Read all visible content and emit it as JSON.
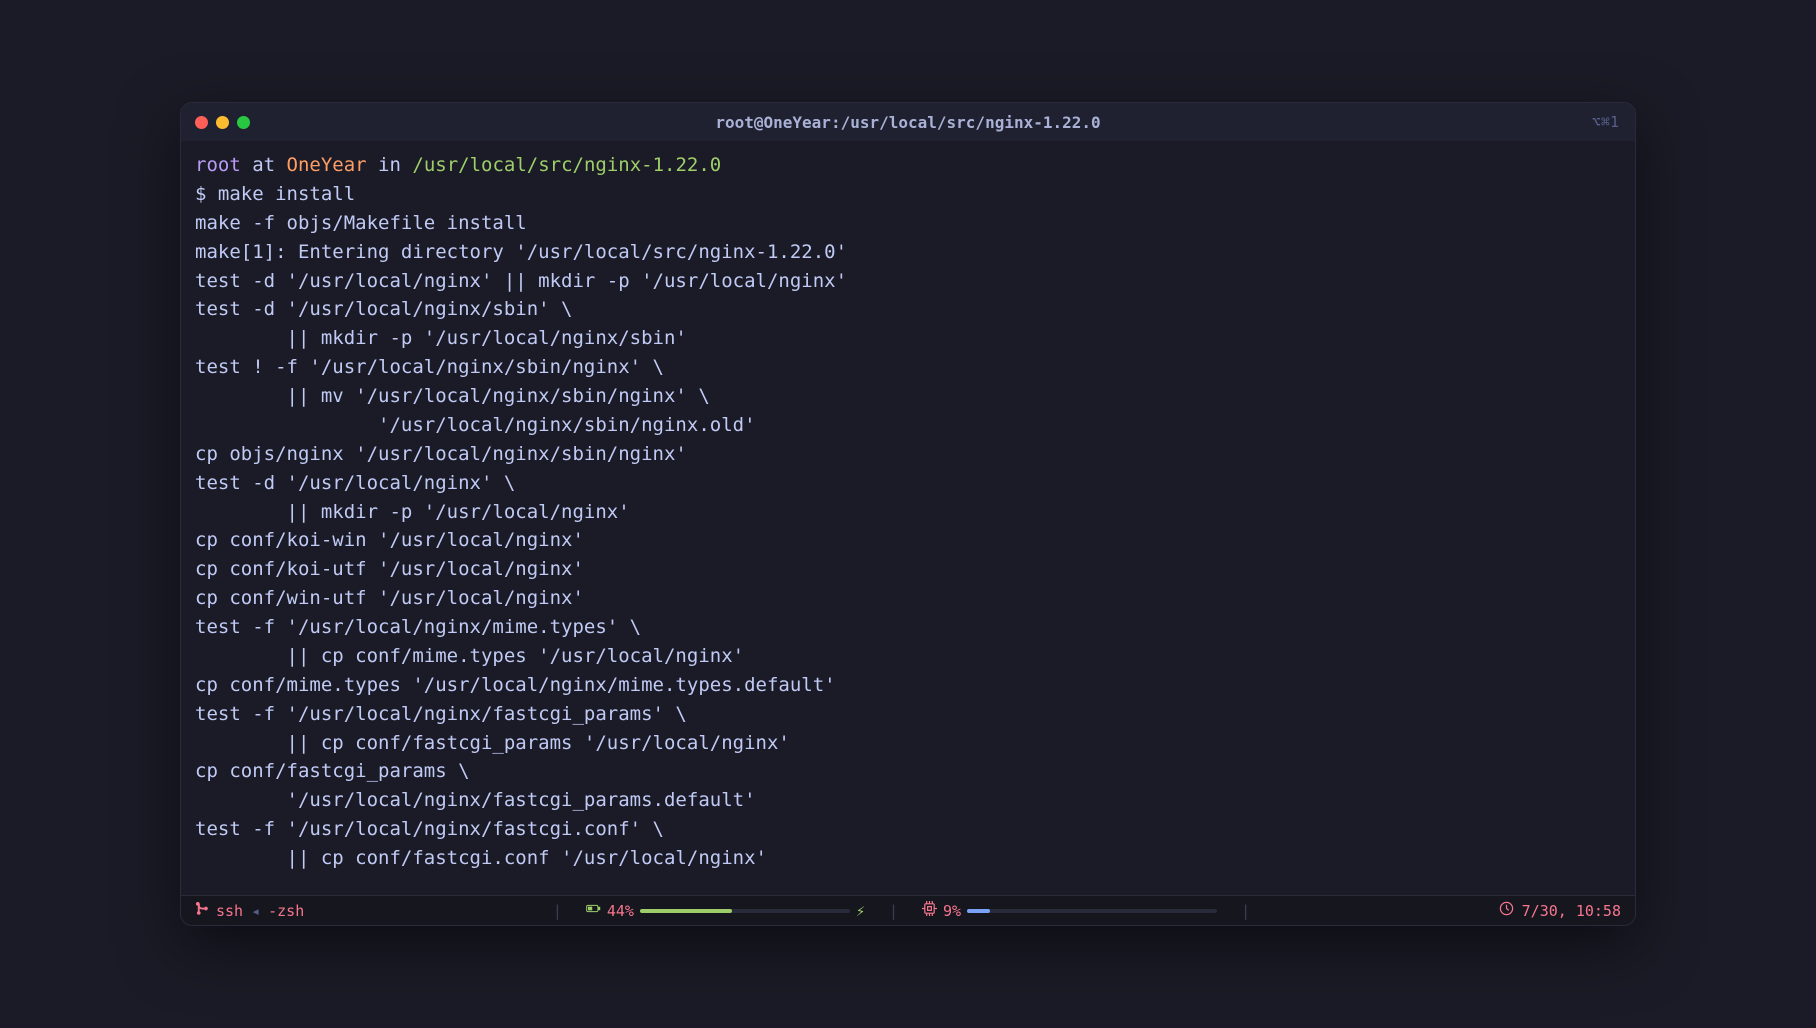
{
  "window": {
    "title": "root@OneYear:/usr/local/src/nginx-1.22.0",
    "shortcut": "⌥⌘1"
  },
  "prompt": {
    "user": "root",
    "at": " at ",
    "host": "OneYear",
    "in": " in ",
    "path": "/usr/local/src/nginx-1.22.0",
    "symbol": "$ ",
    "command": "make install"
  },
  "output_lines": [
    "make -f objs/Makefile install",
    "make[1]: Entering directory '/usr/local/src/nginx-1.22.0'",
    "test -d '/usr/local/nginx' || mkdir -p '/usr/local/nginx'",
    "test -d '/usr/local/nginx/sbin' \\",
    "        || mkdir -p '/usr/local/nginx/sbin'",
    "test ! -f '/usr/local/nginx/sbin/nginx' \\",
    "        || mv '/usr/local/nginx/sbin/nginx' \\",
    "                '/usr/local/nginx/sbin/nginx.old'",
    "cp objs/nginx '/usr/local/nginx/sbin/nginx'",
    "test -d '/usr/local/nginx' \\",
    "        || mkdir -p '/usr/local/nginx'",
    "cp conf/koi-win '/usr/local/nginx'",
    "cp conf/koi-utf '/usr/local/nginx'",
    "cp conf/win-utf '/usr/local/nginx'",
    "test -f '/usr/local/nginx/mime.types' \\",
    "        || cp conf/mime.types '/usr/local/nginx'",
    "cp conf/mime.types '/usr/local/nginx/mime.types.default'",
    "test -f '/usr/local/nginx/fastcgi_params' \\",
    "        || cp conf/fastcgi_params '/usr/local/nginx'",
    "cp conf/fastcgi_params \\",
    "        '/usr/local/nginx/fastcgi_params.default'",
    "test -f '/usr/local/nginx/fastcgi.conf' \\",
    "        || cp conf/fastcgi.conf '/usr/local/nginx'"
  ],
  "status": {
    "process_left": "ssh",
    "process_right": "-zsh",
    "battery_label": "44%",
    "battery_pct": 44,
    "cpu_label": "9%",
    "cpu_pct": 9,
    "clock": "7/30, 10:58"
  },
  "colors": {
    "accent_pink": "#f7768e",
    "accent_green": "#9ece6a",
    "accent_blue": "#7aa2f7",
    "accent_orange": "#ff9e64",
    "accent_purple": "#bb9af7"
  }
}
